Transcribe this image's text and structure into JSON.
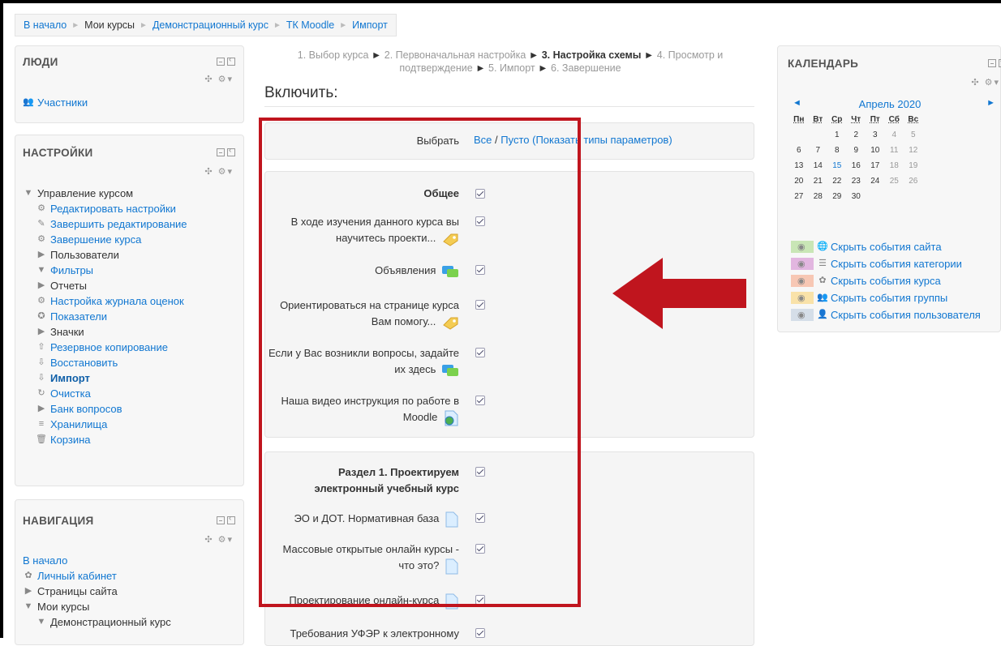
{
  "breadcrumb": [
    "В начало",
    "Мои курсы",
    "Демонстрационный курс",
    "ТК Moodle",
    "Импорт"
  ],
  "blocks": {
    "people": {
      "title": "ЛЮДИ",
      "items": [
        "Участники"
      ]
    },
    "settings": {
      "title": "НАСТРОЙКИ",
      "items": [
        "Управление курсом",
        "Редактировать настройки",
        "Завершить редактирование",
        "Завершение курса",
        "Пользователи",
        "Фильтры",
        "Отчеты",
        "Настройка журнала оценок",
        "Показатели",
        "Значки",
        "Резервное копирование",
        "Восстановить",
        "Импорт",
        "Очистка",
        "Банк вопросов",
        "Хранилища",
        "Корзина"
      ]
    },
    "navigation": {
      "title": "НАВИГАЦИЯ",
      "items": [
        "В начало",
        "Личный кабинет",
        "Страницы сайта",
        "Мои курсы",
        "Демонстрационный курс"
      ]
    }
  },
  "steps": {
    "s1": "1. Выбор курса",
    "s2": "2. Первоначальная настройка",
    "s3": "3. Настройка схемы",
    "s4": "4. Просмотр и подтверждение",
    "s5": "5. Импорт",
    "s6": "6. Завершение",
    "arrow": "►"
  },
  "heading": "Включить:",
  "select_row": {
    "label": "Выбрать",
    "all": "Все",
    "slash": " / ",
    "none": "Пусто",
    "show_types": "(Показать типы параметров)"
  },
  "section0": {
    "title": "Общее",
    "items": [
      "В ходе изучения данного курса вы",
      "научитесь проекти...",
      "Объявления",
      "Ориентироваться на странице курса",
      "Вам помогу...",
      "Если у Вас возникли вопросы, задайте",
      "их здесь",
      "Наша видео инструкция по работе в",
      "Moodle"
    ]
  },
  "section1": {
    "title_line1": "Раздел 1. Проектируем",
    "title_line2": "электронный учебный курс",
    "items": [
      "ЭО и ДОТ. Нормативная база",
      "Массовые открытые онлайн курсы -",
      "что это?",
      "Проектирование онлайн-курса",
      "Требования УФЭР к электронному"
    ]
  },
  "calendar": {
    "title": "КАЛЕНДАРЬ",
    "month": "Апрель 2020",
    "prev": "◄",
    "next": "►",
    "dow": [
      "Пн",
      "Вт",
      "Ср",
      "Чт",
      "Пт",
      "Сб",
      "Вс"
    ],
    "weeks": [
      [
        "",
        "",
        "1",
        "2",
        "3",
        "4",
        "5"
      ],
      [
        "6",
        "7",
        "8",
        "9",
        "10",
        "11",
        "12"
      ],
      [
        "13",
        "14",
        "15",
        "16",
        "17",
        "18",
        "19"
      ],
      [
        "20",
        "21",
        "22",
        "23",
        "24",
        "25",
        "26"
      ],
      [
        "27",
        "28",
        "29",
        "30",
        "",
        "",
        ""
      ]
    ],
    "today": "15",
    "legend": [
      {
        "label": "Скрыть события сайта",
        "color": "#c9e6b6"
      },
      {
        "label": "Скрыть события категории",
        "color": "#e2b6e0"
      },
      {
        "label": "Скрыть события курса",
        "color": "#f7c7b4"
      },
      {
        "label": "Скрыть события группы",
        "color": "#f9e2a9"
      },
      {
        "label": "Скрыть события пользователя",
        "color": "#d5dee8"
      }
    ]
  },
  "colors": {
    "link": "#1177d1",
    "annotation_red": "#c0151e"
  }
}
